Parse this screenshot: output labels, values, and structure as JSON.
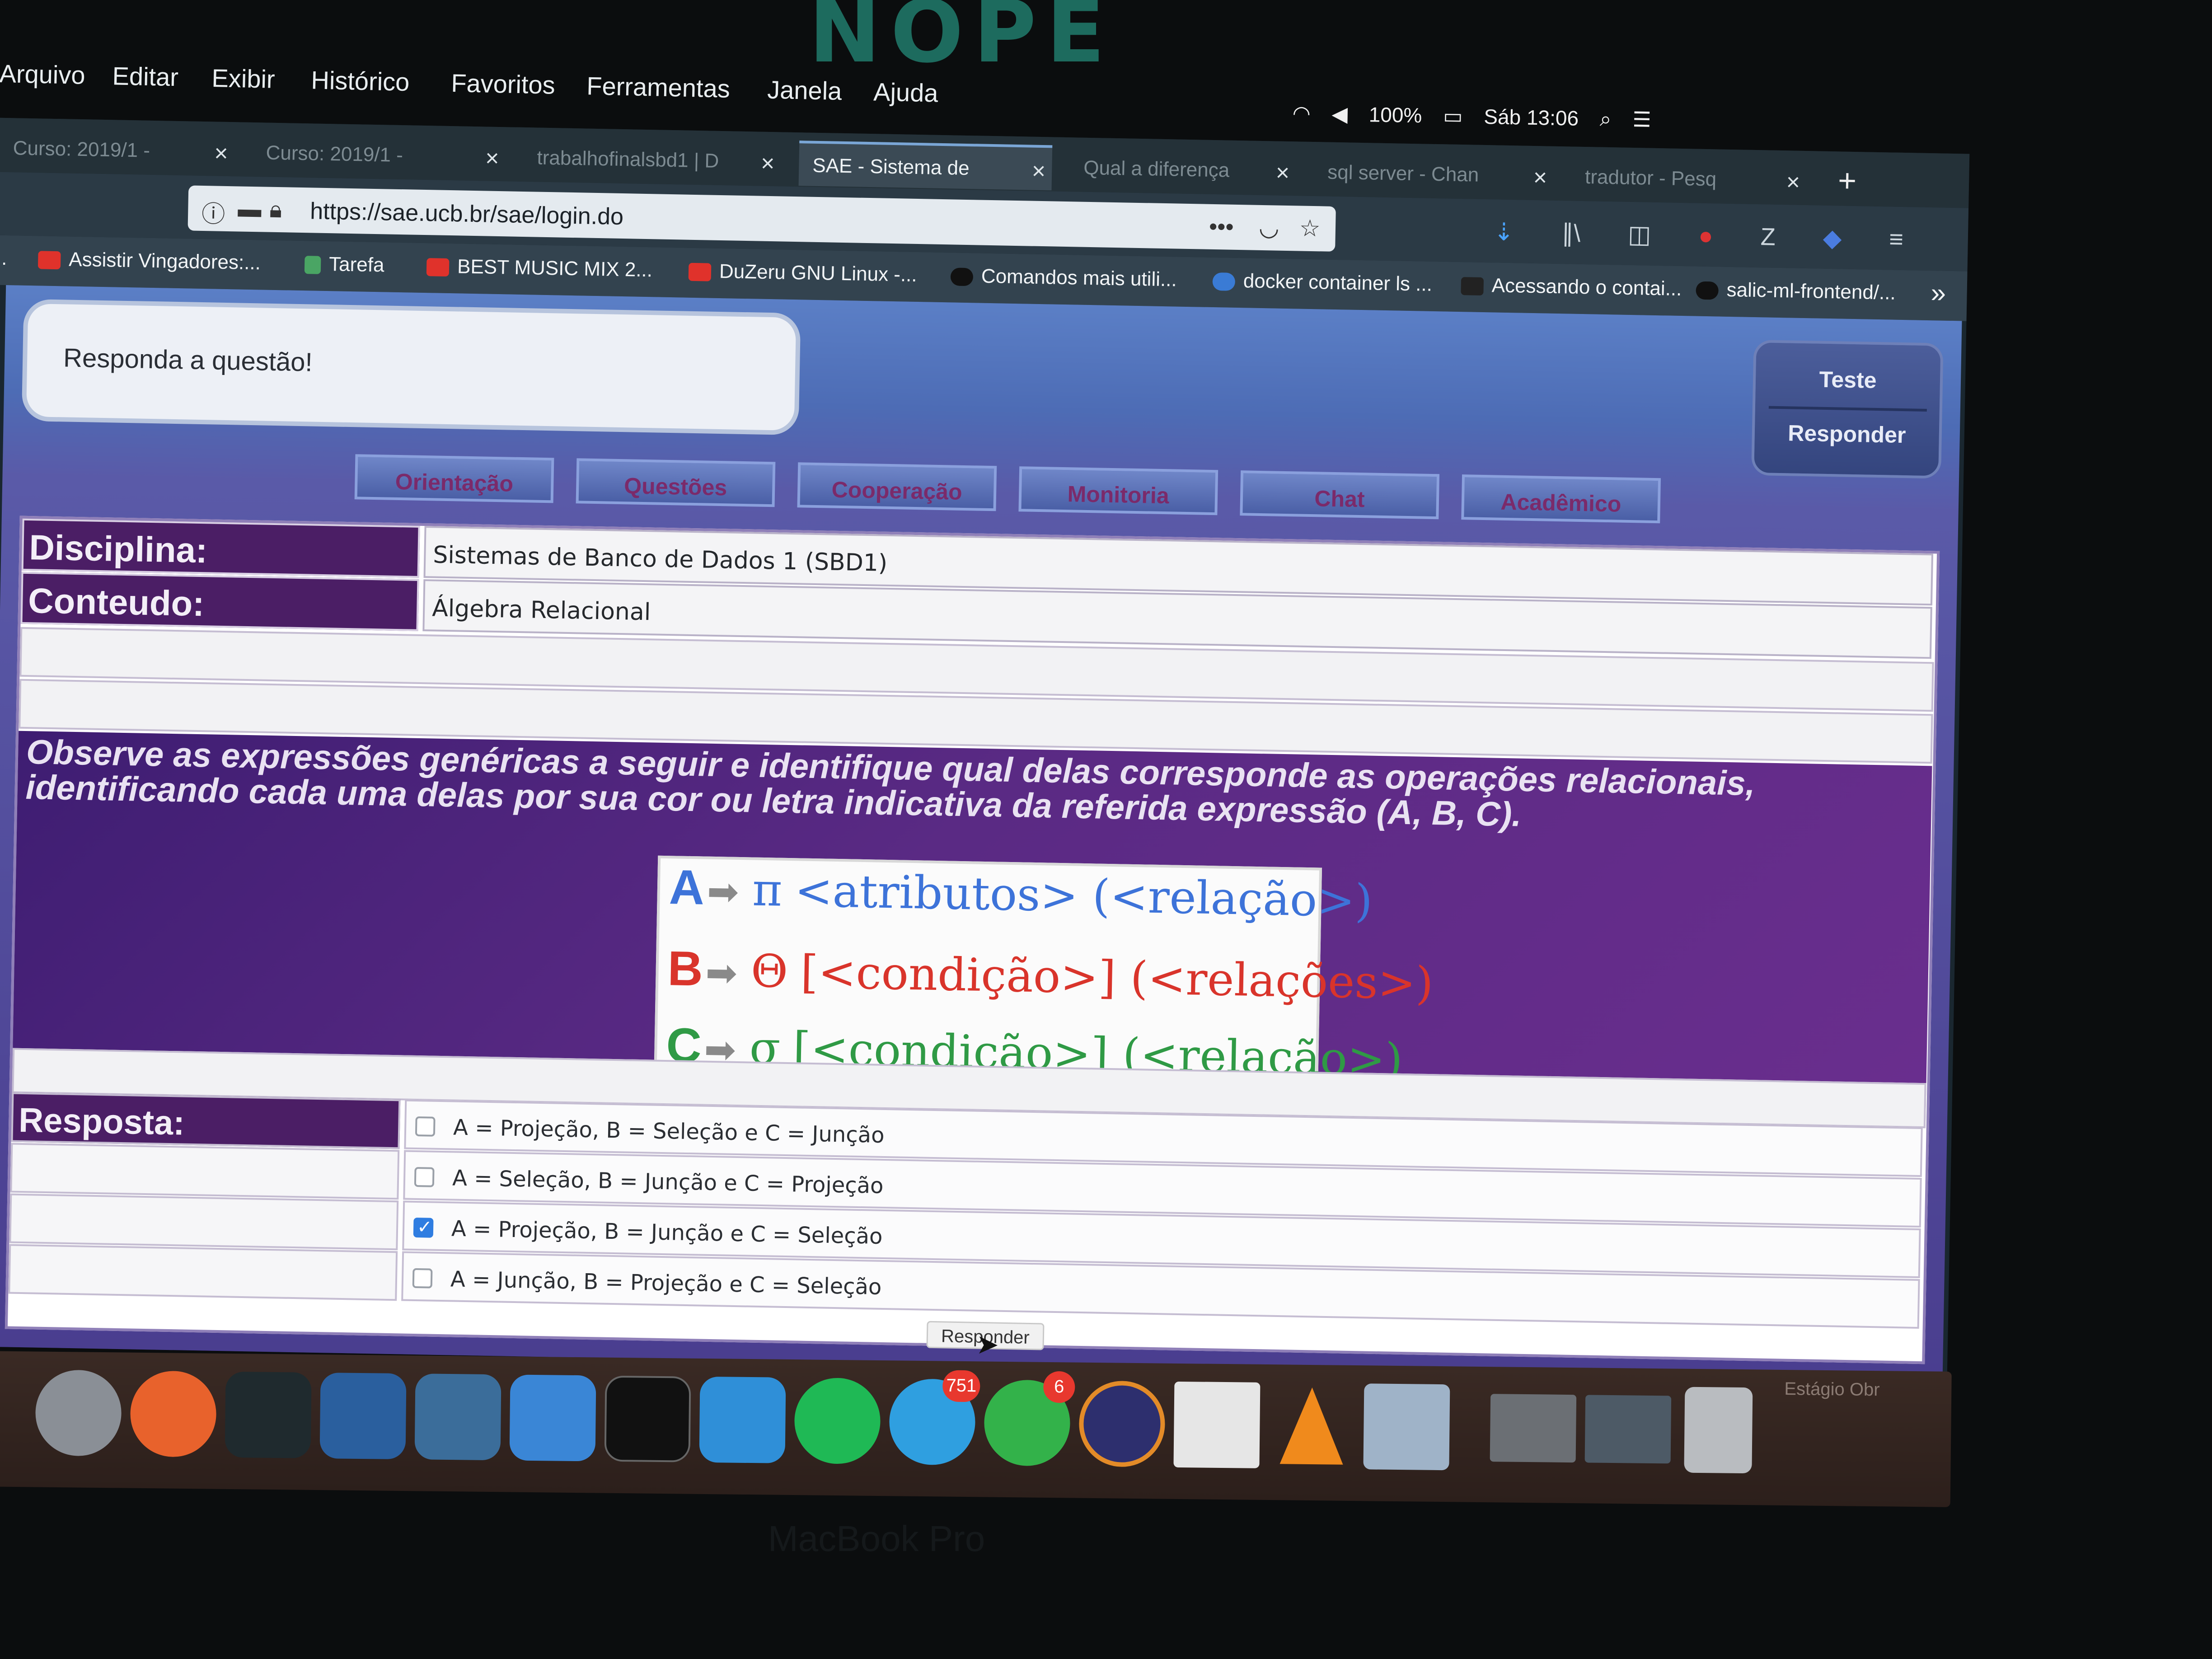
{
  "system": {
    "bezel_logo": "NOPE",
    "menu": [
      "Arquivo",
      "Editar",
      "Exibir",
      "Histórico",
      "Favoritos",
      "Ferramentas",
      "Janela",
      "Ajuda"
    ],
    "battery": "100%",
    "clock": "Sáb 13:06"
  },
  "browser": {
    "tabs": [
      {
        "label": "Curso: 2019/1 -",
        "active": false
      },
      {
        "label": "Curso: 2019/1 -",
        "active": false
      },
      {
        "label": "trabalhofinalsbd1 | D",
        "active": false
      },
      {
        "label": "SAE - Sistema de",
        "active": true
      },
      {
        "label": "Qual a diferença",
        "active": false
      },
      {
        "label": "sql server - Chan",
        "active": false
      },
      {
        "label": "tradutor - Pesq",
        "active": false
      }
    ],
    "url": "https://sae.ucb.br/sae/login.do",
    "bookmarks": [
      {
        "label": "d...",
        "color": "#555555"
      },
      {
        "label": "Assistir Vingadores:...",
        "color": "#e0322b"
      },
      {
        "label": "Tarefa",
        "color": "#4aa564"
      },
      {
        "label": "BEST MUSIC MIX 2...",
        "color": "#e0322b"
      },
      {
        "label": "DuZeru GNU Linux -...",
        "color": "#e0322b"
      },
      {
        "label": "Comandos mais utili...",
        "color": "#111111"
      },
      {
        "label": "docker container ls ...",
        "color": "#3a7bd5"
      },
      {
        "label": "Acessando o contai...",
        "color": "#222222"
      },
      {
        "label": "salic-ml-frontend/...",
        "color": "#111111"
      }
    ]
  },
  "page": {
    "notice": "Responda a questão!",
    "side_button": {
      "top": "Teste",
      "bottom": "Responder"
    },
    "nav_tabs": [
      "Orientação",
      "Questões",
      "Cooperação",
      "Monitoria",
      "Chat",
      "Acadêmico"
    ],
    "disciplina_label": "Disciplina:",
    "disciplina_value": "Sistemas de Banco de Dados 1 (SBD1)",
    "conteudo_label": "Conteudo:",
    "conteudo_value": "Álgebra Relacional",
    "question": "Observe as expressões genéricas a seguir e identifique qual delas corresponde as operações relacionais, identificando cada uma delas por sua cor ou letra indicativa da referida expressão (A, B, C).",
    "expressions": [
      {
        "letter": "A",
        "symbol": "π",
        "text": "<atributos> (<relação>)",
        "color": "#3d73d9"
      },
      {
        "letter": "B",
        "symbol": "Θ",
        "text": "[<condição>] (<relações>)",
        "color": "#d9342b"
      },
      {
        "letter": "C",
        "symbol": "σ",
        "text": "[<condição>]  (<relação>)",
        "color": "#2f9a45"
      }
    ],
    "answer_label": "Resposta:",
    "options": [
      {
        "text": "A = Projeção, B = Seleção e C = Junção",
        "checked": false
      },
      {
        "text": "A = Seleção, B = Junção e C = Projeção",
        "checked": false
      },
      {
        "text": "A = Projeção, B = Junção e C = Seleção",
        "checked": true
      },
      {
        "text": "A = Junção, B = Projeção e C = Seleção",
        "checked": false
      }
    ],
    "submit": "Responder"
  },
  "dock": {
    "apps": [
      {
        "name": "launchpad-icon",
        "color": "#8a8f96"
      },
      {
        "name": "firefox-icon",
        "color": "#e8622c"
      },
      {
        "name": "pycharm-icon",
        "color": "#1f2a2e"
      },
      {
        "name": "vscode-icon",
        "color": "#2a5f9e"
      },
      {
        "name": "mysql-workbench-icon",
        "color": "#3b6d9a"
      },
      {
        "name": "xcode-icon",
        "color": "#3a86d6"
      },
      {
        "name": "terminal-icon",
        "color": "#111111"
      },
      {
        "name": "docker-icon",
        "color": "#2f8fd8"
      },
      {
        "name": "spotify-icon",
        "color": "#1fb955"
      },
      {
        "name": "telegram-icon",
        "color": "#2f9fe0",
        "badge": "751"
      },
      {
        "name": "whatsapp-icon",
        "color": "#33b24a",
        "badge": "6"
      },
      {
        "name": "eclipse-icon",
        "color": "#2d2f6e"
      },
      {
        "name": "java-icon",
        "color": "#e6e6e6"
      },
      {
        "name": "vlc-icon",
        "color": "#f08a1c"
      },
      {
        "name": "preview-icon",
        "color": "#9fb3c8"
      },
      {
        "name": "screenshot-thumb-icon",
        "color": "#6b6f74"
      },
      {
        "name": "screenshot-thumb-icon",
        "color": "#4d5a66"
      },
      {
        "name": "trash-icon",
        "color": "#b9bcc0"
      }
    ],
    "label": "Estágio Obr"
  },
  "laptop_label": "MacBook Pro"
}
